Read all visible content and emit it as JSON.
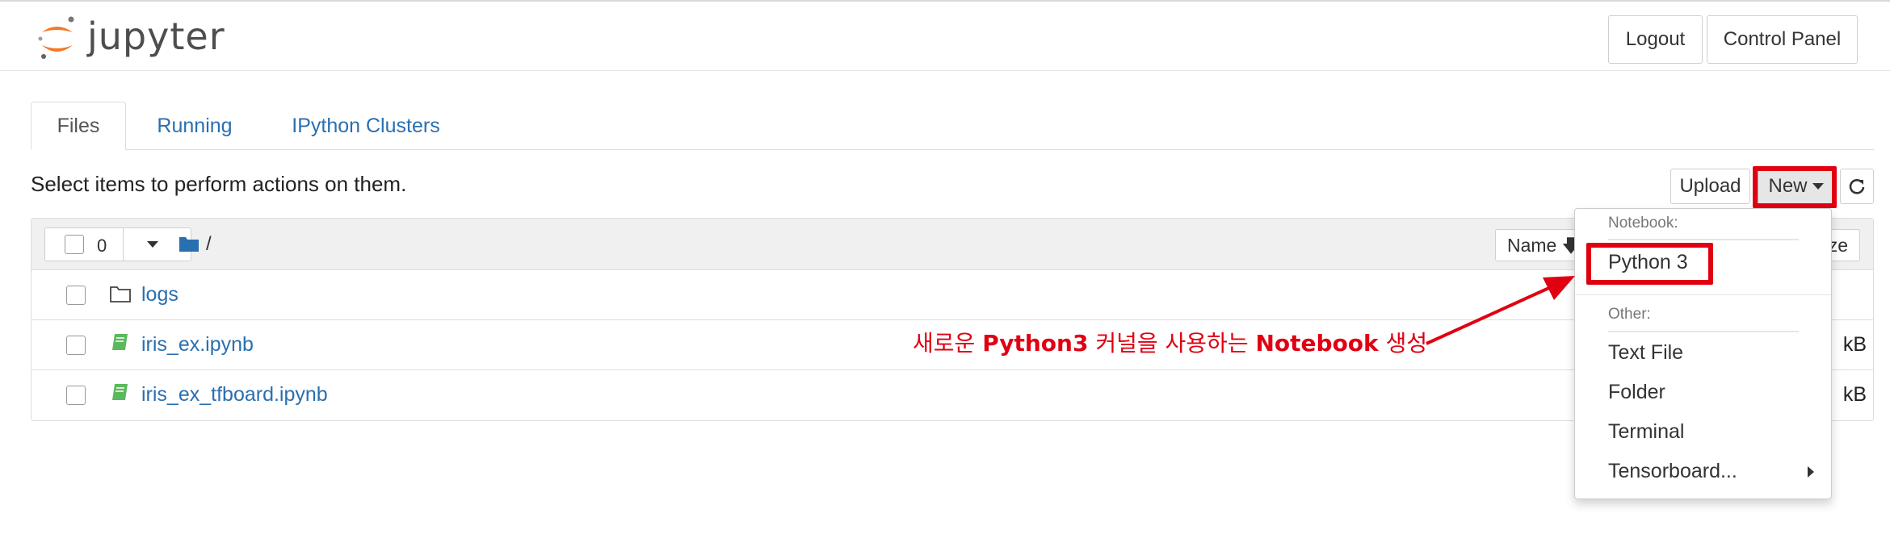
{
  "header": {
    "logo_text": "jupyter",
    "logout_label": "Logout",
    "control_panel_label": "Control Panel"
  },
  "tabs": [
    {
      "label": "Files",
      "active": true
    },
    {
      "label": "Running",
      "active": false
    },
    {
      "label": "IPython Clusters",
      "active": false
    }
  ],
  "toolbar": {
    "instruction": "Select items to perform actions on them.",
    "upload_label": "Upload",
    "new_label": "New",
    "refresh_icon": "refresh-icon"
  },
  "list": {
    "selected_count": "0",
    "breadcrumb": "/",
    "sort_name_label": "Name",
    "sort_size_label": "ze",
    "rows": [
      {
        "name": "logs",
        "type": "folder",
        "size": ""
      },
      {
        "name": "iris_ex.ipynb",
        "type": "notebook",
        "size": "kB"
      },
      {
        "name": "iris_ex_tfboard.ipynb",
        "type": "notebook",
        "size": "kB"
      }
    ]
  },
  "new_menu": {
    "notebook_header": "Notebook:",
    "python3": "Python 3",
    "other_header": "Other:",
    "text_file": "Text File",
    "folder": "Folder",
    "terminal": "Terminal",
    "tensorboard": "Tensorboard..."
  },
  "annotation": {
    "part1": "새로운 ",
    "part2": "Python3",
    "part3": " 커널을 사용하는 ",
    "part4": "Notebook",
    "part5": " 생성"
  },
  "colors": {
    "highlight_red": "#e00012",
    "link_blue": "#2a6fb0",
    "notebook_green": "#5cb85c",
    "logo_orange": "#f37726"
  }
}
